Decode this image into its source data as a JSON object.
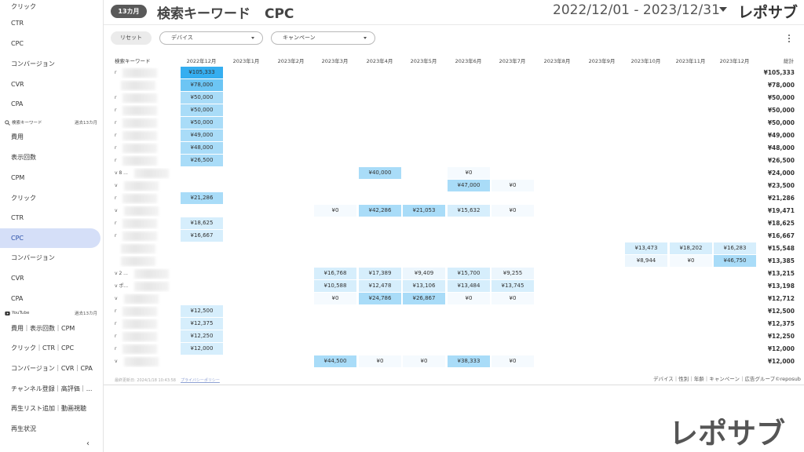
{
  "sidebar": {
    "items_top": [
      {
        "label": "クリック",
        "top": 0
      },
      {
        "label": "CTR",
        "top": 0
      },
      {
        "label": "CPC",
        "top": 0
      },
      {
        "label": "コンバージョン",
        "top": 0
      },
      {
        "label": "CVR",
        "top": 0
      },
      {
        "label": "CPA",
        "top": 0
      }
    ],
    "section_keyword": {
      "title": "検索キーワード",
      "range": "過去13カ月"
    },
    "items_keyword": [
      "費用",
      "表示回数",
      "CPM",
      "クリック",
      "CTR",
      "CPC",
      "コンバージョン",
      "CVR",
      "CPA"
    ],
    "active_item": "CPC",
    "section_youtube": {
      "title": "YouTube",
      "range": "過去13カ月"
    },
    "items_youtube": [
      "費用｜表示回数｜CPM",
      "クリック｜CTR｜CPC",
      "コンバージョン｜CVR｜CPA",
      "チャンネル登録｜高評価｜...",
      "再生リスト追加｜動画視聴",
      "再生状況"
    ],
    "collapse_label": "‹"
  },
  "header": {
    "period_badge": "13カ月",
    "title": "検索キーワード",
    "metric": "CPC",
    "date_range": "2022/12/01 - 2023/12/31",
    "brand": "レポサブ"
  },
  "filters": {
    "reset_label": "リセット",
    "device_label": "デバイス",
    "campaign_label": "キャンペーン"
  },
  "table": {
    "row_header": "検索キーワード",
    "months": [
      "2022年12月",
      "2023年1月",
      "2023年2月",
      "2023年3月",
      "2023年4月",
      "2023年5月",
      "2023年6月",
      "2023年7月",
      "2023年8月",
      "2023年9月",
      "2023年10月",
      "2023年11月",
      "2023年12月"
    ],
    "total_header": "総計",
    "rows": [
      {
        "label": "r",
        "cells": [
          "¥105,333",
          "",
          "",
          "",
          "",
          "",
          "",
          "",
          "",
          "",
          "",
          "",
          ""
        ],
        "total": "¥105,333"
      },
      {
        "label": "",
        "cells": [
          "¥78,000",
          "",
          "",
          "",
          "",
          "",
          "",
          "",
          "",
          "",
          "",
          "",
          ""
        ],
        "total": "¥78,000"
      },
      {
        "label": "r",
        "cells": [
          "¥50,000",
          "",
          "",
          "",
          "",
          "",
          "",
          "",
          "",
          "",
          "",
          "",
          ""
        ],
        "total": "¥50,000"
      },
      {
        "label": "r",
        "cells": [
          "¥50,000",
          "",
          "",
          "",
          "",
          "",
          "",
          "",
          "",
          "",
          "",
          "",
          ""
        ],
        "total": "¥50,000"
      },
      {
        "label": "r",
        "cells": [
          "¥50,000",
          "",
          "",
          "",
          "",
          "",
          "",
          "",
          "",
          "",
          "",
          "",
          ""
        ],
        "total": "¥50,000"
      },
      {
        "label": "r",
        "cells": [
          "¥49,000",
          "",
          "",
          "",
          "",
          "",
          "",
          "",
          "",
          "",
          "",
          "",
          ""
        ],
        "total": "¥49,000"
      },
      {
        "label": "r",
        "cells": [
          "¥48,000",
          "",
          "",
          "",
          "",
          "",
          "",
          "",
          "",
          "",
          "",
          "",
          ""
        ],
        "total": "¥48,000"
      },
      {
        "label": "r",
        "cells": [
          "¥26,500",
          "",
          "",
          "",
          "",
          "",
          "",
          "",
          "",
          "",
          "",
          "",
          ""
        ],
        "total": "¥26,500"
      },
      {
        "label": "v        8 ...",
        "cells": [
          "",
          "",
          "",
          "",
          "¥40,000",
          "",
          "¥0",
          "",
          "",
          "",
          "",
          "",
          ""
        ],
        "total": "¥24,000"
      },
      {
        "label": "v",
        "cells": [
          "",
          "",
          "",
          "",
          "",
          "",
          "¥47,000",
          "¥0",
          "",
          "",
          "",
          "",
          ""
        ],
        "total": "¥23,500"
      },
      {
        "label": "r",
        "cells": [
          "¥21,286",
          "",
          "",
          "",
          "",
          "",
          "",
          "",
          "",
          "",
          "",
          "",
          ""
        ],
        "total": "¥21,286"
      },
      {
        "label": "v",
        "cells": [
          "",
          "",
          "",
          "¥0",
          "¥42,286",
          "¥21,053",
          "¥15,632",
          "¥0",
          "",
          "",
          "",
          "",
          ""
        ],
        "total": "¥19,471"
      },
      {
        "label": "r",
        "cells": [
          "¥18,625",
          "",
          "",
          "",
          "",
          "",
          "",
          "",
          "",
          "",
          "",
          "",
          ""
        ],
        "total": "¥18,625"
      },
      {
        "label": "r",
        "cells": [
          "¥16,667",
          "",
          "",
          "",
          "",
          "",
          "",
          "",
          "",
          "",
          "",
          "",
          ""
        ],
        "total": "¥16,667"
      },
      {
        "label": "",
        "cells": [
          "",
          "",
          "",
          "",
          "",
          "",
          "",
          "",
          "",
          "",
          "¥13,473",
          "¥18,202",
          "¥16,283"
        ],
        "total": "¥15,548"
      },
      {
        "label": "",
        "cells": [
          "",
          "",
          "",
          "",
          "",
          "",
          "",
          "",
          "",
          "",
          "¥8,944",
          "¥0",
          "¥46,750"
        ],
        "total": "¥13,385"
      },
      {
        "label": "v        2 ...",
        "cells": [
          "",
          "",
          "",
          "¥16,768",
          "¥17,389",
          "¥9,409",
          "¥15,700",
          "¥9,255",
          "",
          "",
          "",
          "",
          ""
        ],
        "total": "¥13,215"
      },
      {
        "label": "v        ポ...",
        "cells": [
          "",
          "",
          "",
          "¥10,588",
          "¥12,478",
          "¥13,106",
          "¥13,484",
          "¥13,745",
          "",
          "",
          "",
          "",
          ""
        ],
        "total": "¥13,198"
      },
      {
        "label": "v",
        "cells": [
          "",
          "",
          "",
          "¥0",
          "¥24,786",
          "¥26,867",
          "¥0",
          "¥0",
          "",
          "",
          "",
          "",
          ""
        ],
        "total": "¥12,712"
      },
      {
        "label": "r",
        "cells": [
          "¥12,500",
          "",
          "",
          "",
          "",
          "",
          "",
          "",
          "",
          "",
          "",
          "",
          ""
        ],
        "total": "¥12,500"
      },
      {
        "label": "r",
        "cells": [
          "¥12,375",
          "",
          "",
          "",
          "",
          "",
          "",
          "",
          "",
          "",
          "",
          "",
          ""
        ],
        "total": "¥12,375"
      },
      {
        "label": "r",
        "cells": [
          "¥12,250",
          "",
          "",
          "",
          "",
          "",
          "",
          "",
          "",
          "",
          "",
          "",
          ""
        ],
        "total": "¥12,250"
      },
      {
        "label": "r",
        "cells": [
          "¥12,000",
          "",
          "",
          "",
          "",
          "",
          "",
          "",
          "",
          "",
          "",
          "",
          ""
        ],
        "total": "¥12,000"
      },
      {
        "label": "v",
        "cells": [
          "",
          "",
          "",
          "¥44,500",
          "¥0",
          "¥0",
          "¥38,333",
          "¥0",
          "",
          "",
          "",
          "",
          ""
        ],
        "total": "¥12,000"
      }
    ],
    "updated_note": "最終更新日: 2024/1/18 10:43:58",
    "privacy_link": "プライバシーポリシー",
    "breakdown_note": "デバイス｜性別｜年齢｜キャンペーン｜広告グループ©reposub",
    "heat_colors": {
      "max": "#35aef0",
      "high": "#6cc5f4",
      "mid": "#a9dcf8",
      "low": "#d6eefc",
      "min": "#ecf6fd",
      "zero": "#f5fafe"
    }
  },
  "watermark": {
    "brand": "レポサブ"
  }
}
